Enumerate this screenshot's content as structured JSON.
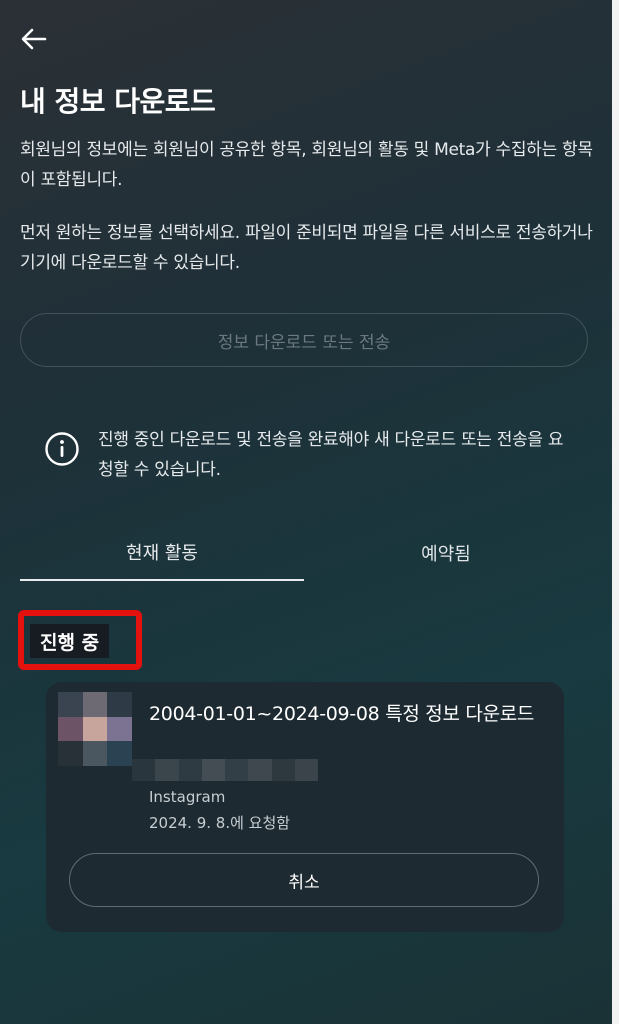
{
  "header": {
    "back_icon": "arrow-left-icon",
    "title": "내 정보 다운로드"
  },
  "intro": {
    "paragraph1": "회원님의 정보에는 회원님이 공유한 항목, 회원님의 활동 및 Meta가 수집하는 항목이 포함됩니다.",
    "paragraph2": "먼저 원하는 정보를 선택하세요. 파일이 준비되면 파일을 다른 서비스로 전송하거나 기기에 다운로드할 수 있습니다."
  },
  "download_button": {
    "label": "정보 다운로드 또는 전송",
    "enabled": false
  },
  "notice": {
    "icon": "info-icon",
    "text": "진행 중인 다운로드 및 전송을 완료해야 새 다운로드 또는 전송을 요청할 수 있습니다."
  },
  "tabs": [
    {
      "label": "현재 활동",
      "selected": true
    },
    {
      "label": "예약됨",
      "selected": false
    }
  ],
  "section": {
    "label": "진행 중",
    "highlight_color": "#e3120f"
  },
  "request_card": {
    "title": "2004-01-01~2024-09-08 특정 정보 다운로드",
    "source": "Instagram",
    "requested": "2024. 9. 8.에 요청함",
    "cancel_label": "취소"
  }
}
